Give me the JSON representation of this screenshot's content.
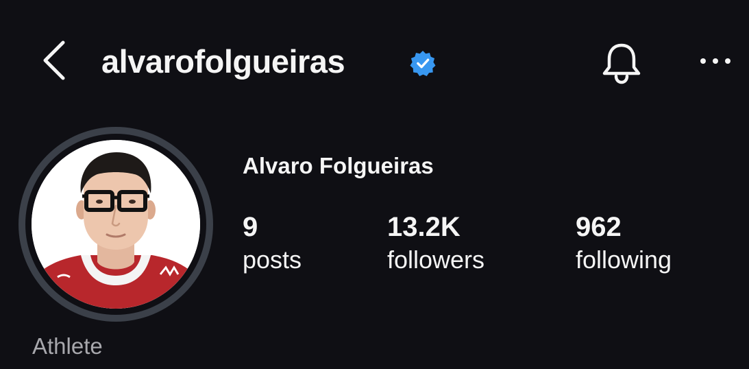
{
  "header": {
    "username": "alvarofolgueiras",
    "back_icon": "chevron-left-icon",
    "verified_icon": "verified-badge-icon",
    "notifications_icon": "bell-icon",
    "more_icon": "more-horizontal-icon"
  },
  "profile": {
    "display_name": "Alvaro Folgueiras",
    "category": "Athlete",
    "stats": {
      "posts": {
        "count": "9",
        "label": "posts"
      },
      "followers": {
        "count": "13.2K",
        "label": "followers"
      },
      "following": {
        "count": "962",
        "label": "following"
      }
    }
  },
  "colors": {
    "background": "#0f0f14",
    "text": "#f5f5f5",
    "muted_text": "#a8a8ad",
    "verified_blue": "#3897f0",
    "avatar_ring": "#3b4049",
    "jersey_red": "#b8272c"
  }
}
